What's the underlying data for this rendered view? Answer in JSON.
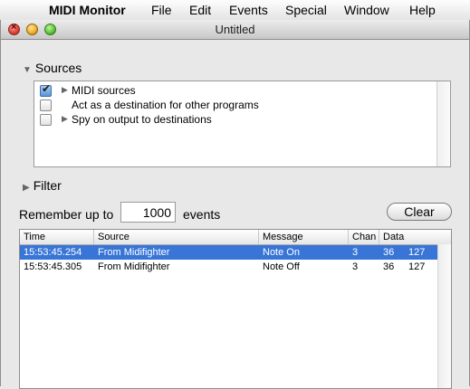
{
  "menubar": {
    "app_name": "MIDI Monitor",
    "items": [
      "File",
      "Edit",
      "Events",
      "Special",
      "Window",
      "Help"
    ]
  },
  "window": {
    "title": "Untitled"
  },
  "sources": {
    "label": "Sources",
    "expanded": true,
    "items": [
      {
        "label": "MIDI sources",
        "checked": true,
        "has_disclosure": true
      },
      {
        "label": "Act as a destination for other programs",
        "checked": false,
        "has_disclosure": false
      },
      {
        "label": "Spy on output to destinations",
        "checked": false,
        "has_disclosure": true
      }
    ]
  },
  "filter": {
    "label": "Filter",
    "expanded": false
  },
  "remember": {
    "prefix": "Remember up to",
    "count": "1000",
    "suffix": "events"
  },
  "clear_button": {
    "label": "Clear"
  },
  "table": {
    "columns": [
      "Time",
      "Source",
      "Message",
      "Chan",
      "Data"
    ],
    "rows": [
      {
        "time": "15:53:45.254",
        "source": "From Midifighter",
        "message": "Note On",
        "chan": "3",
        "data1": "36",
        "data2": "127",
        "selected": true
      },
      {
        "time": "15:53:45.305",
        "source": "From Midifighter",
        "message": "Note Off",
        "chan": "3",
        "data1": "36",
        "data2": "127",
        "selected": false
      }
    ]
  },
  "colors": {
    "selection": "#3875d7",
    "close": "#e2423a",
    "minimize": "#f2b12b",
    "zoom": "#5ec93a"
  }
}
